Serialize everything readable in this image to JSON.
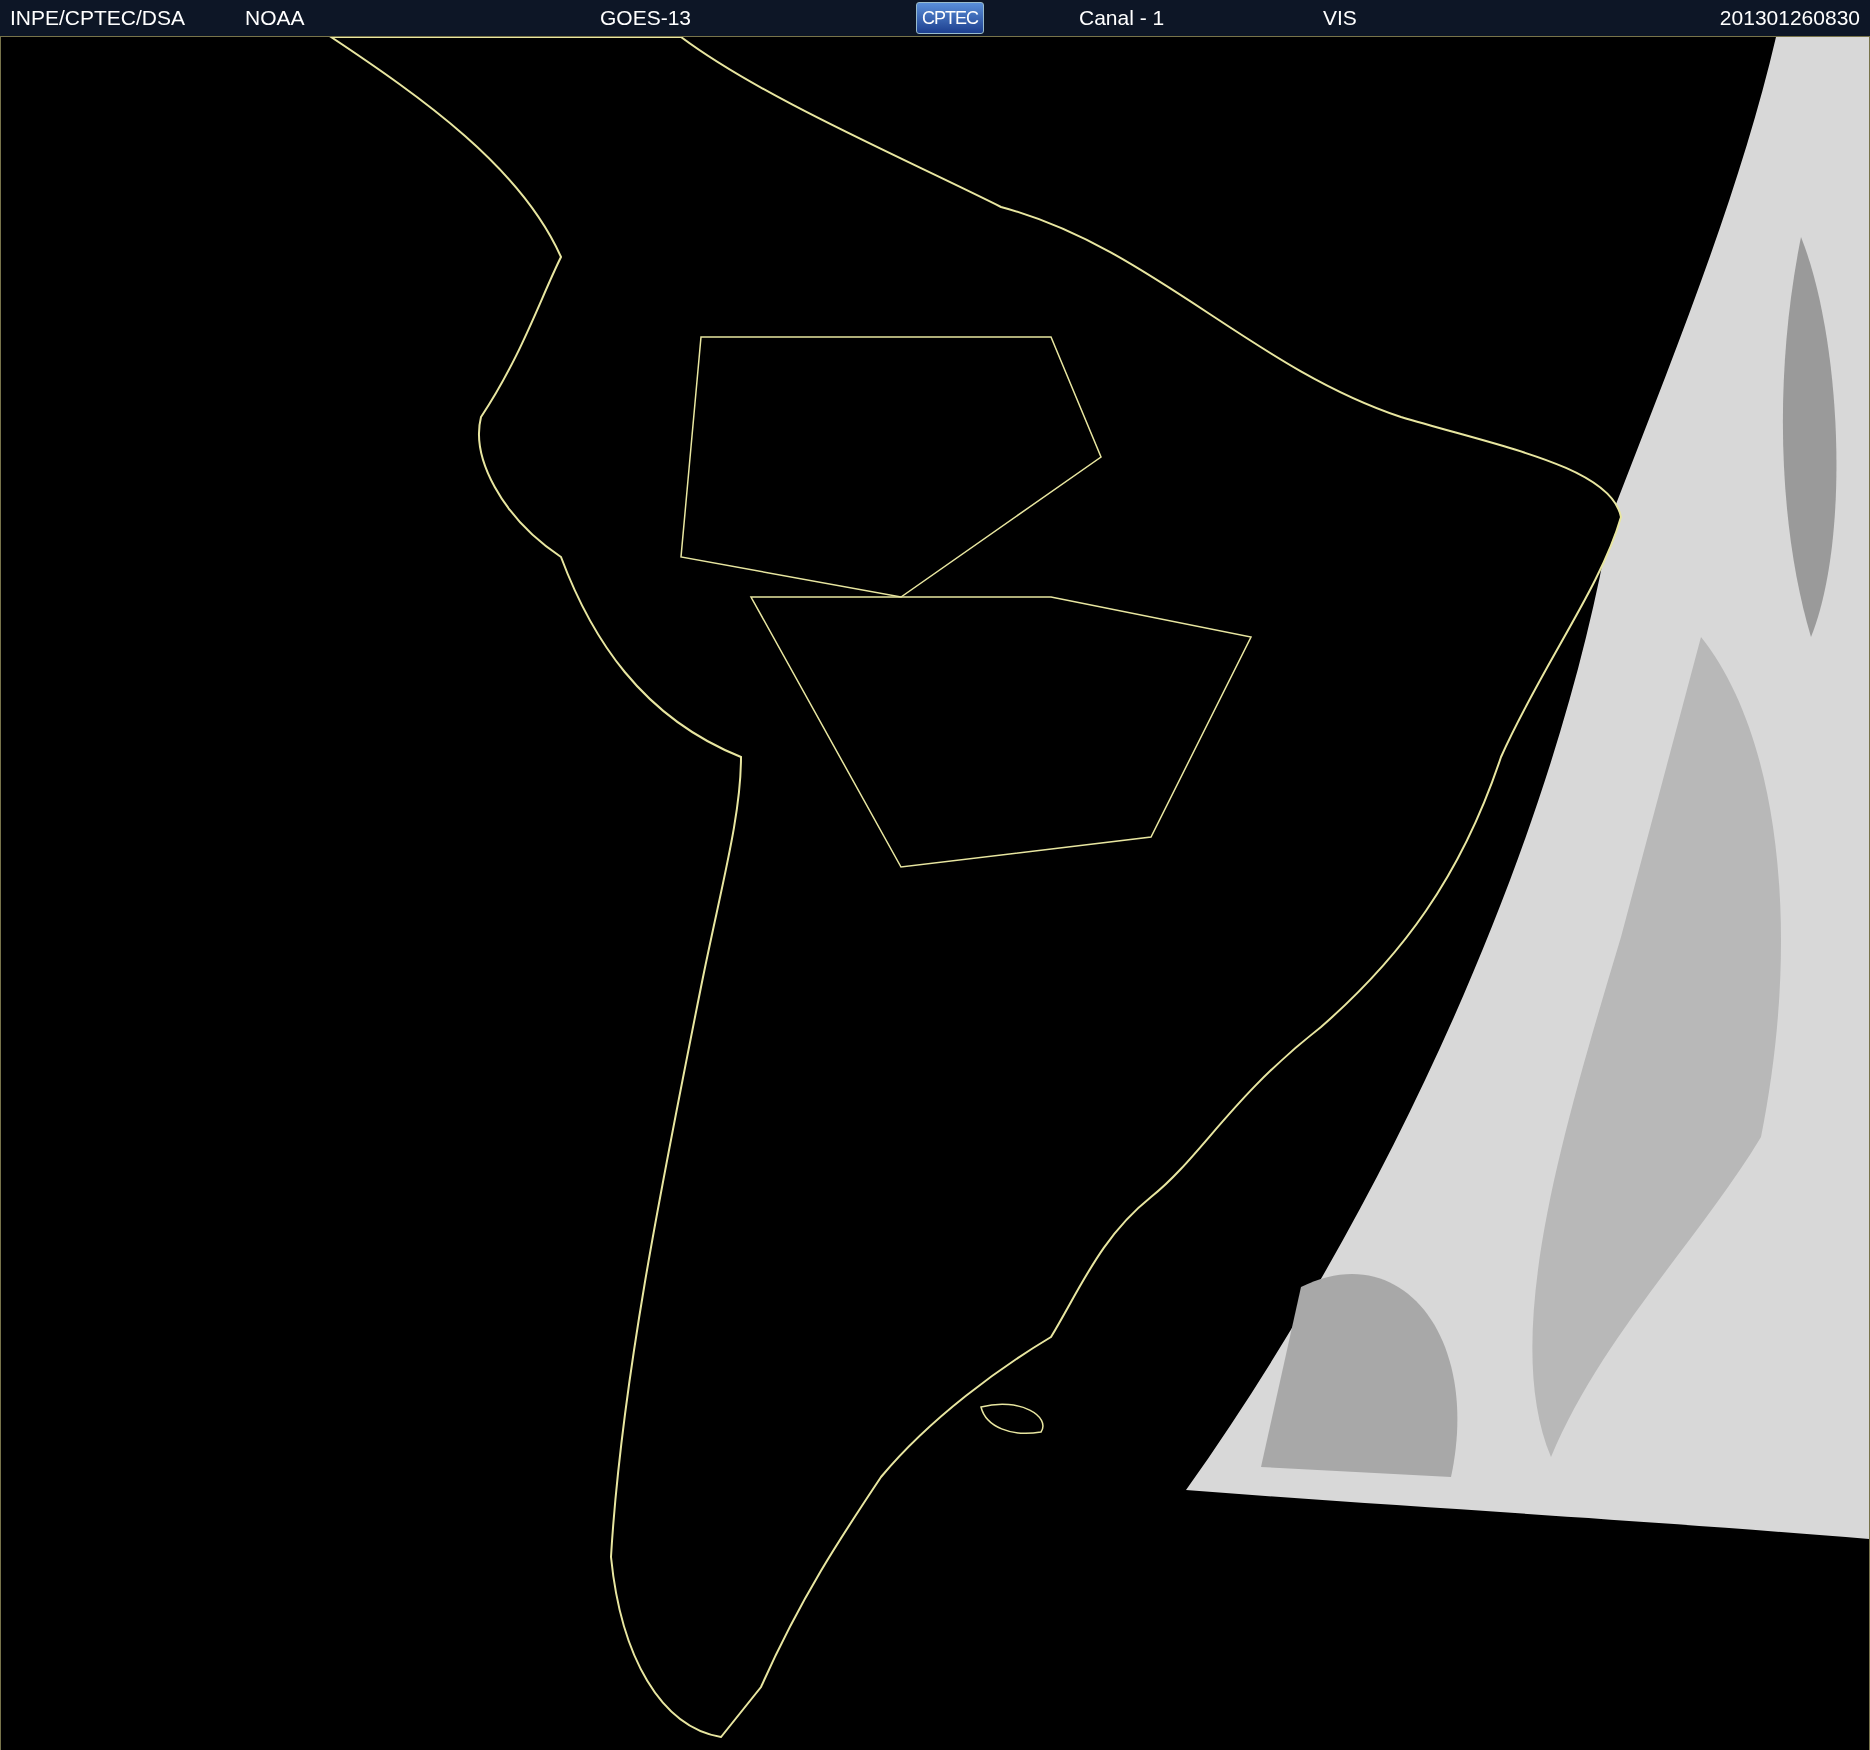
{
  "header": {
    "agency": "INPE/CPTEC/DSA",
    "source": "NOAA",
    "satellite": "GOES-13",
    "logo": "CPTEC",
    "channel": "Canal - 1",
    "band": "VIS",
    "timestamp": "201301260830"
  }
}
